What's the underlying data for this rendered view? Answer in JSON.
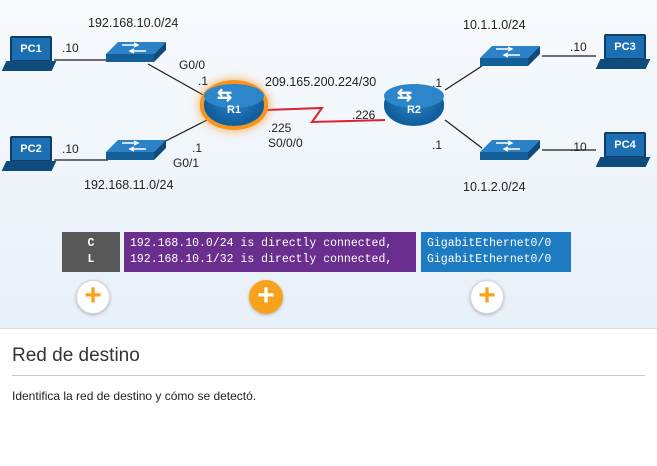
{
  "topology": {
    "r1": "R1",
    "r2": "R2",
    "pcs": {
      "pc1": "PC1",
      "pc2": "PC2",
      "pc3": "PC3",
      "pc4": "PC4"
    },
    "networks": {
      "lan1": "192.168.10.0/24",
      "lan2": "192.168.11.0/24",
      "wan": "209.165.200.224/30",
      "lan3": "10.1.1.0/24",
      "lan4": "10.1.2.0/24"
    },
    "interfaces": {
      "g00": "G0/0",
      "g01": "G0/1",
      "s000": "S0/0/0"
    },
    "hosts": {
      "pc1": ".10",
      "pc2": ".10",
      "pc3": ".10",
      "pc4": ".10",
      "r1_g00": ".1",
      "r1_g01": ".1",
      "r1_s": ".225",
      "r2_wan": ".226",
      "r2_top": ".1",
      "r2_bottom": ".1"
    }
  },
  "route_table": {
    "codes": [
      "C",
      "L"
    ],
    "entries": [
      "192.168.10.0/24 is directly connected,",
      "192.168.10.1/32 is directly connected,"
    ],
    "interfaces": [
      "GigabitEthernet0/0",
      "GigabitEthernet0/0"
    ]
  },
  "panel": {
    "title": "Red de destino",
    "text": "Identifica la red de destino y cómo se detectó."
  },
  "colors": {
    "code_bg": "#585858",
    "network_bg": "#6a2f8e",
    "interface_bg": "#1d7bc2",
    "accent": "#f7a21c",
    "highlight": "#f7941d"
  },
  "icons": [
    "pc-icon",
    "switch-icon",
    "router-icon",
    "plus-icon"
  ]
}
